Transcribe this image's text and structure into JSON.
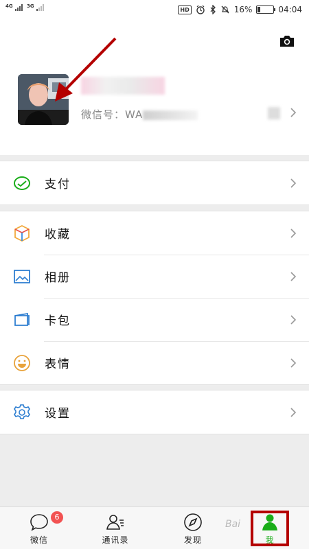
{
  "status_bar": {
    "network_1": "4G",
    "network_2": "3G",
    "badge_hd": "HD",
    "battery_percent": "16%",
    "battery_level": 0.16,
    "time": "04:04"
  },
  "profile": {
    "wechat_id_label": "微信号：",
    "wechat_id_value": "WA"
  },
  "menu": {
    "pay": "支付",
    "favorites": "收藏",
    "album": "相册",
    "cards": "卡包",
    "stickers": "表情",
    "settings": "设置"
  },
  "tabbar": {
    "chats": "微信",
    "chats_badge": "6",
    "contacts": "通讯录",
    "discover": "发现",
    "me": "我"
  },
  "watermark": "Bai",
  "colors": {
    "accent_green": "#1aad19",
    "badge_red": "#f25252",
    "annotation_red": "#b40000"
  }
}
